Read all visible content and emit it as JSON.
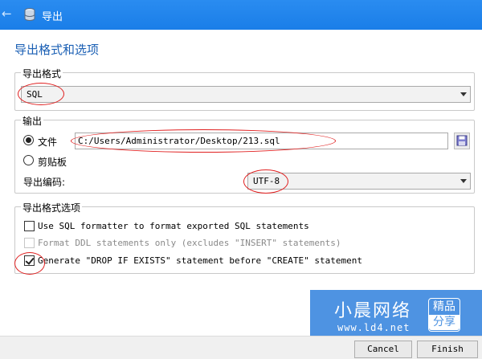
{
  "window": {
    "title": "导出",
    "back_icon": "back-arrow-icon",
    "app_icon": "database-icon"
  },
  "page": {
    "heading": "导出格式和选项"
  },
  "format_group": {
    "legend": "导出格式",
    "selected": "SQL"
  },
  "output_group": {
    "legend": "输出",
    "file_label": "文件",
    "file_path": "C:/Users/Administrator/Desktop/213.sql",
    "clipboard_label": "剪贴板",
    "encoding_label": "导出编码:",
    "encoding_value": "UTF-8",
    "file_selected": true
  },
  "options_group": {
    "legend": "导出格式选项",
    "option1": {
      "label": "Use SQL formatter to format exported SQL statements",
      "checked": false,
      "enabled": true
    },
    "option2": {
      "label": "Format DDL statements only (excludes \"INSERT\" statements)",
      "checked": false,
      "enabled": false
    },
    "option3": {
      "label": "Generate \"DROP IF EXISTS\" statement before \"CREATE\" statement",
      "checked": true,
      "enabled": true
    }
  },
  "watermark": {
    "name": "小晨网络",
    "url": "www.ld4.net",
    "badge_line1": "精品",
    "badge_line2": "分享"
  },
  "buttons": {
    "cancel": "Cancel",
    "finish": "Finish"
  },
  "colors": {
    "titlebar": "#1a7ee8",
    "heading": "#1a5fb4",
    "annotation": "#e02020",
    "watermark": "#3f8ae0"
  }
}
